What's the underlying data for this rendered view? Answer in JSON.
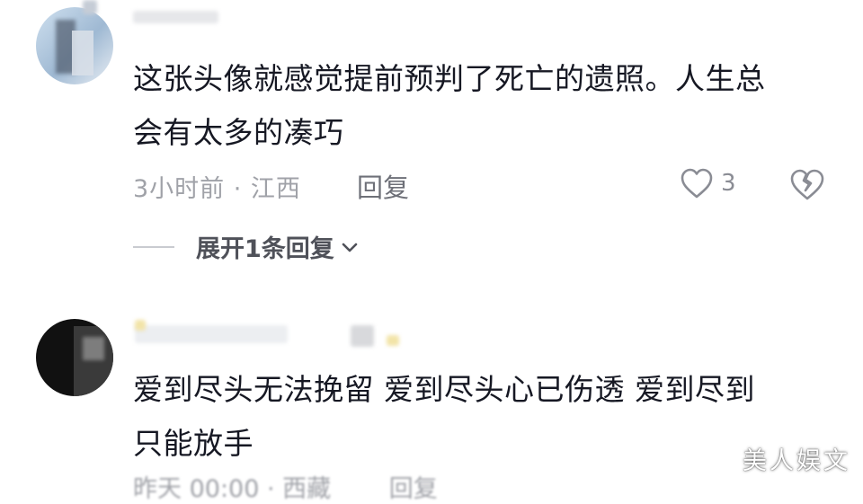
{
  "comments": [
    {
      "text_line1": "这张头像就感觉提前预判了死亡的遗照。人生总",
      "text_line2": "会有太多的凑巧",
      "meta": "3小时前 · 江西",
      "reply_label": "回复",
      "like_count": "3",
      "expand_label": "展开1条回复"
    },
    {
      "text_line1": "爱到尽头无法挽留  爱到尽头心已伤透  爱到尽到",
      "text_line2": "只能放手",
      "meta_partial": "昨天 00:00 · 西藏",
      "reply_partial": "回复"
    }
  ],
  "watermark": "美人娱文",
  "icons": {
    "like": "heart-outline-icon",
    "dislike": "broken-heart-icon",
    "expand": "chevron-down-icon"
  }
}
